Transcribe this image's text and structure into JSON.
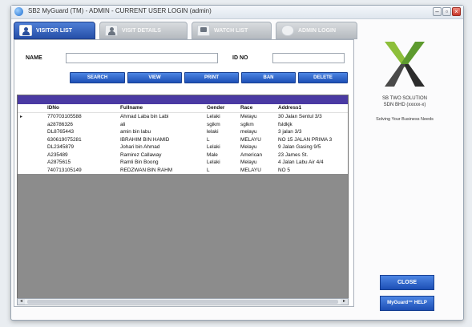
{
  "window": {
    "title": "SB2 MyGuard (TM) - ADMIN - CURRENT USER LOGIN (admin)"
  },
  "tabs": [
    {
      "label": "VISITOR LIST",
      "active": true
    },
    {
      "label": "VISIT DETAILS",
      "active": false
    },
    {
      "label": "WATCH LIST",
      "active": false
    },
    {
      "label": "ADMIN LOGIN",
      "active": false
    }
  ],
  "search": {
    "name_label": "NAME",
    "name_value": "",
    "idno_label": "ID NO",
    "idno_value": ""
  },
  "actions": {
    "search": "SEARCH",
    "view": "VIEW",
    "print": "PRINT",
    "ban": "BAN",
    "delete": "DELETE"
  },
  "grid": {
    "columns": [
      "IDNo",
      "Fullname",
      "Gender",
      "Race",
      "Address1"
    ],
    "rows": [
      [
        "770703105588",
        "Ahmad Laba bin Labi",
        "Lelaki",
        "Melayu",
        "30 Jalan Sentul 3/3"
      ],
      [
        "a28786326",
        "ali",
        "sgikm",
        "sglkm",
        "fsldkjk"
      ],
      [
        "DL8765443",
        "amin bin labu",
        "lelaki",
        "melayu",
        "3 jalan 3/3"
      ],
      [
        "630619075281",
        "IBRAHIM BIN HAMID",
        "L",
        "MELAYU",
        "NO 15 JALAN PRIMA 3"
      ],
      [
        "DL2345879",
        "Johari bin Ahmad",
        "Lelaki",
        "Melayu",
        "9 Jalan Gasing 9/5"
      ],
      [
        "A235489",
        "Ramirez Callaway",
        "Male",
        "American",
        "23 James St."
      ],
      [
        "A2875615",
        "Ramli Bin Boong",
        "Lelaki",
        "Melayu",
        "4 Jalan Labu Air 4/4"
      ],
      [
        "740713105149",
        "REDZWAN BIN RAHM",
        "L",
        "MELAYU",
        "NO 5"
      ]
    ]
  },
  "branding": {
    "company_line1": "SB TWO SOLUTION",
    "company_line2": "SDN BHD (xxxxx-x)",
    "tagline": "Solving Your Business Needs"
  },
  "side_buttons": {
    "close": "CLOSE",
    "help": "MyGuard™ HELP"
  },
  "colors": {
    "accent": "#2a5bc4",
    "grid_header_band": "#4a3aa3",
    "grid_empty": "#8c8c8c"
  },
  "icons": {
    "visitor_tab": "visitor-icon",
    "visit_details_tab": "visitor-icon",
    "watch_list_tab": "monitor-icon",
    "admin_tab": "info-icon"
  }
}
